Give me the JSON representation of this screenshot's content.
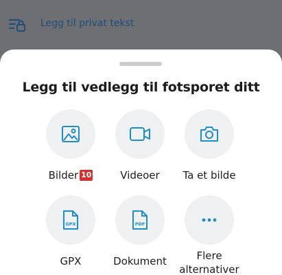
{
  "background": {
    "row_label": "Legg til privat tekst",
    "row_icon": "private-text-icon"
  },
  "sheet": {
    "title": "Legg til vedlegg til fotsporet ditt",
    "options": [
      {
        "label": "Bilder",
        "icon": "image-icon",
        "badge": "10"
      },
      {
        "label": "Videoer",
        "icon": "video-icon"
      },
      {
        "label": "Ta et bilde",
        "icon": "camera-icon"
      },
      {
        "label": "GPX",
        "icon": "gpx-file-icon",
        "icon_text": "GPX"
      },
      {
        "label": "Dokument",
        "icon": "pdf-file-icon",
        "icon_text": "PDF"
      },
      {
        "label": "Flere alternativer",
        "icon": "more-icon"
      }
    ]
  },
  "colors": {
    "accent": "#1f8dc8",
    "overlay": "#6d6f72",
    "circle": "#eff0f1",
    "badge": "#d32f2f"
  }
}
